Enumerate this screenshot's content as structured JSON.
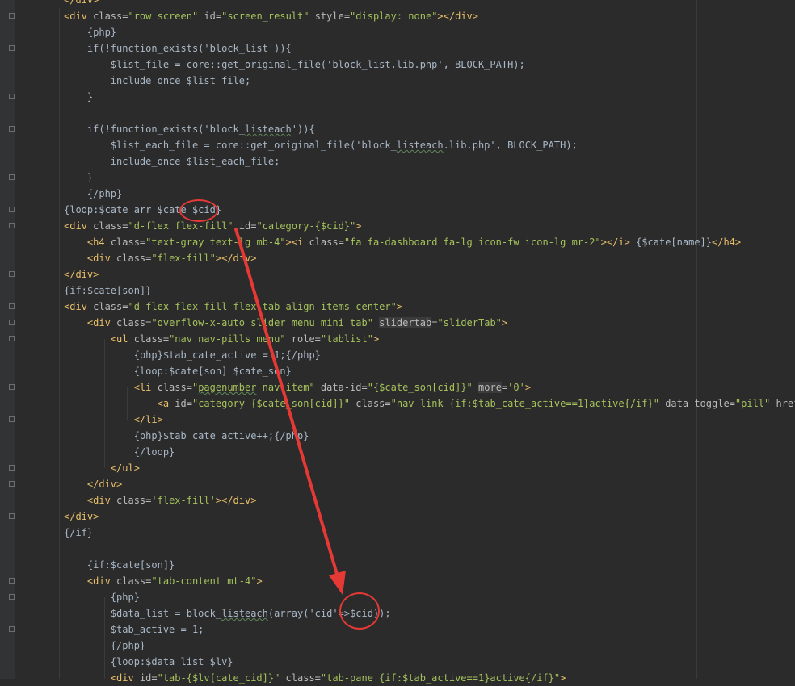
{
  "lines": [
    {
      "ind": 0,
      "parts": [
        [
          "tag",
          "</div>"
        ]
      ]
    },
    {
      "ind": 0,
      "parts": [
        [
          "tag",
          "<div "
        ],
        [
          "attr",
          "class="
        ],
        [
          "str",
          "\"row screen\""
        ],
        [
          "attr",
          " id="
        ],
        [
          "str",
          "\"screen_result\""
        ],
        [
          "attr",
          " style="
        ],
        [
          "str",
          "\"display: none\""
        ],
        [
          "tag",
          "></div>"
        ]
      ]
    },
    {
      "ind": 1,
      "parts": [
        [
          "txt",
          "{php}"
        ]
      ]
    },
    {
      "ind": 1,
      "parts": [
        [
          "txt",
          "if(!function_exists('block_list')){"
        ]
      ]
    },
    {
      "ind": 2,
      "parts": [
        [
          "txt",
          "$list_file = core::get_original_file('block_list.lib.php', BLOCK_PATH);"
        ]
      ]
    },
    {
      "ind": 2,
      "parts": [
        [
          "txt",
          "include_once $list_file;"
        ]
      ]
    },
    {
      "ind": 1,
      "parts": [
        [
          "txt",
          "}"
        ]
      ]
    },
    {
      "ind": 0,
      "parts": []
    },
    {
      "ind": 1,
      "parts": [
        [
          "txt",
          "if(!function_exists('block_"
        ],
        [
          "sq",
          "listeach"
        ],
        [
          "txt",
          "')){"
        ]
      ]
    },
    {
      "ind": 2,
      "parts": [
        [
          "txt",
          "$list_each_file = core::get_original_file('block_"
        ],
        [
          "sq",
          "listeach"
        ],
        [
          "txt",
          ".lib.php', BLOCK_PATH);"
        ]
      ]
    },
    {
      "ind": 2,
      "parts": [
        [
          "txt",
          "include_once $list_each_file;"
        ]
      ]
    },
    {
      "ind": 1,
      "parts": [
        [
          "txt",
          "}"
        ]
      ]
    },
    {
      "ind": 1,
      "parts": [
        [
          "txt",
          "{/php}"
        ]
      ]
    },
    {
      "ind": 0,
      "parts": [
        [
          "txt",
          "{loop:$cate_arr $cate $cid}"
        ]
      ]
    },
    {
      "ind": 0,
      "parts": [
        [
          "tag",
          "<div "
        ],
        [
          "attr",
          "class="
        ],
        [
          "str",
          "\"d-flex flex-fill\""
        ],
        [
          "attr",
          " id="
        ],
        [
          "str",
          "\"category-{$cid}\""
        ],
        [
          "tag",
          ">"
        ]
      ]
    },
    {
      "ind": 1,
      "parts": [
        [
          "tag",
          "<h4 "
        ],
        [
          "attr",
          "class="
        ],
        [
          "str",
          "\"text-gray text-lg mb-4\""
        ],
        [
          "tag",
          "><i "
        ],
        [
          "attr",
          "class="
        ],
        [
          "str",
          "\"fa fa-dashboard fa-lg icon-fw icon-lg mr-2\""
        ],
        [
          "tag",
          "></i> "
        ],
        [
          "txt",
          "{$cate[name]}"
        ],
        [
          "tag",
          "</h4>"
        ]
      ]
    },
    {
      "ind": 1,
      "parts": [
        [
          "tag",
          "<div "
        ],
        [
          "attr",
          "class="
        ],
        [
          "str",
          "\"flex-fill\""
        ],
        [
          "tag",
          "></div>"
        ]
      ]
    },
    {
      "ind": 0,
      "parts": [
        [
          "tag",
          "</div>"
        ]
      ]
    },
    {
      "ind": 0,
      "parts": [
        [
          "txt",
          "{if:$cate[son]}"
        ]
      ]
    },
    {
      "ind": 0,
      "parts": [
        [
          "tag",
          "<div "
        ],
        [
          "attr",
          "class="
        ],
        [
          "str",
          "\"d-flex flex-fill flex-tab align-items-center\""
        ],
        [
          "tag",
          ">"
        ]
      ]
    },
    {
      "ind": 1,
      "parts": [
        [
          "tag",
          "<div "
        ],
        [
          "attr",
          "class="
        ],
        [
          "str",
          "\"overflow-x-auto slider_menu mini_tab\""
        ],
        [
          "txt",
          " "
        ],
        [
          "hl",
          "slidertab"
        ],
        [
          "attr",
          "="
        ],
        [
          "str",
          "\"sliderTab\""
        ],
        [
          "tag",
          ">"
        ]
      ]
    },
    {
      "ind": 2,
      "parts": [
        [
          "tag",
          "<ul "
        ],
        [
          "attr",
          "class="
        ],
        [
          "str",
          "\"nav nav-pills menu\""
        ],
        [
          "attr",
          " role="
        ],
        [
          "str",
          "\"tablist\""
        ],
        [
          "tag",
          ">"
        ]
      ]
    },
    {
      "ind": 3,
      "parts": [
        [
          "txt",
          "{php}$tab_cate_active = 1;{/php}"
        ]
      ]
    },
    {
      "ind": 3,
      "parts": [
        [
          "txt",
          "{loop:$cate[son] $cate_son}"
        ]
      ]
    },
    {
      "ind": 3,
      "parts": [
        [
          "tag",
          "<li "
        ],
        [
          "attr",
          "class="
        ],
        [
          "str",
          "\""
        ],
        [
          "sqs",
          "pagenumber"
        ],
        [
          "str",
          " nav-item\""
        ],
        [
          "attr",
          " data-id="
        ],
        [
          "str",
          "\"{$cate_son[cid]}\""
        ],
        [
          "txt",
          " "
        ],
        [
          "hl",
          "more"
        ],
        [
          "attr",
          "="
        ],
        [
          "str",
          "'0'"
        ],
        [
          "tag",
          ">"
        ]
      ]
    },
    {
      "ind": 4,
      "parts": [
        [
          "tag",
          "<a "
        ],
        [
          "attr",
          "id="
        ],
        [
          "str",
          "\"category-{$cate_son[cid]}\""
        ],
        [
          "attr",
          " class="
        ],
        [
          "str",
          "\"nav-link {if:$tab_cate_active==1}active{/if}\""
        ],
        [
          "attr",
          " data-toggle="
        ],
        [
          "str",
          "\"pill\""
        ],
        [
          "attr",
          " href="
        ],
        [
          "str",
          "\"#ta"
        ]
      ]
    },
    {
      "ind": 3,
      "parts": [
        [
          "tag",
          "</li>"
        ]
      ]
    },
    {
      "ind": 3,
      "parts": [
        [
          "txt",
          "{php}$tab_cate_active++;{/php}"
        ]
      ]
    },
    {
      "ind": 3,
      "parts": [
        [
          "txt",
          "{/loop}"
        ]
      ]
    },
    {
      "ind": 2,
      "parts": [
        [
          "tag",
          "</ul>"
        ]
      ]
    },
    {
      "ind": 1,
      "parts": [
        [
          "tag",
          "</div>"
        ]
      ]
    },
    {
      "ind": 1,
      "parts": [
        [
          "tag",
          "<div "
        ],
        [
          "attr",
          "class="
        ],
        [
          "str",
          "'flex-fill'"
        ],
        [
          "tag",
          "></div>"
        ]
      ]
    },
    {
      "ind": 0,
      "parts": [
        [
          "tag",
          "</div>"
        ]
      ]
    },
    {
      "ind": 0,
      "parts": [
        [
          "txt",
          "{/if}"
        ]
      ]
    },
    {
      "ind": 0,
      "parts": []
    },
    {
      "ind": 1,
      "parts": [
        [
          "txt",
          "{if:$cate[son]}"
        ]
      ]
    },
    {
      "ind": 1,
      "parts": [
        [
          "tag",
          "<div "
        ],
        [
          "attr",
          "class="
        ],
        [
          "str",
          "\"tab-content mt-4\""
        ],
        [
          "tag",
          ">"
        ]
      ]
    },
    {
      "ind": 2,
      "parts": [
        [
          "txt",
          "{php}"
        ]
      ]
    },
    {
      "ind": 2,
      "parts": [
        [
          "txt",
          "$data_list = block_"
        ],
        [
          "sq",
          "listeach"
        ],
        [
          "txt",
          "(array('cid'=>$cid));"
        ]
      ]
    },
    {
      "ind": 2,
      "parts": [
        [
          "txt",
          "$tab_active = 1;"
        ]
      ]
    },
    {
      "ind": 2,
      "parts": [
        [
          "txt",
          "{/php}"
        ]
      ]
    },
    {
      "ind": 2,
      "parts": [
        [
          "txt",
          "{loop:$data_list $lv}"
        ]
      ]
    },
    {
      "ind": 2,
      "parts": [
        [
          "tag",
          "<div "
        ],
        [
          "attr",
          "id="
        ],
        [
          "str",
          "\"tab-{$lv[cate_cid]}\""
        ],
        [
          "attr",
          " class="
        ],
        [
          "str",
          "\"tab-pane {if:$tab_active==1}active{/if}\""
        ],
        [
          "tag",
          ">"
        ]
      ]
    }
  ]
}
